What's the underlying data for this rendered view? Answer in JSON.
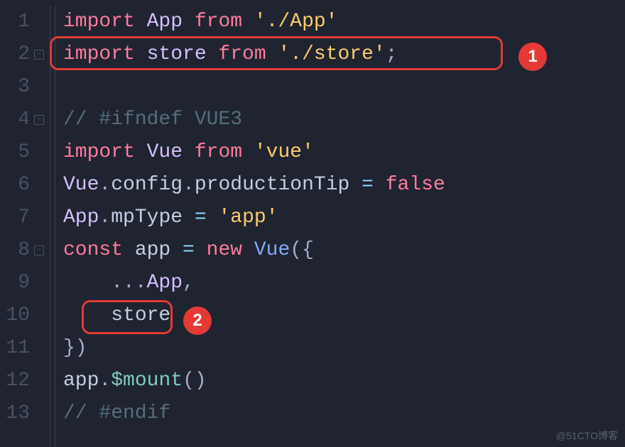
{
  "gutter": {
    "lines": [
      {
        "num": "1",
        "fold": false
      },
      {
        "num": "2",
        "fold": true
      },
      {
        "num": "3",
        "fold": false
      },
      {
        "num": "4",
        "fold": true
      },
      {
        "num": "5",
        "fold": false
      },
      {
        "num": "6",
        "fold": false
      },
      {
        "num": "7",
        "fold": false
      },
      {
        "num": "8",
        "fold": true
      },
      {
        "num": "9",
        "fold": false
      },
      {
        "num": "10",
        "fold": false
      },
      {
        "num": "11",
        "fold": false
      },
      {
        "num": "12",
        "fold": false
      },
      {
        "num": "13",
        "fold": false
      }
    ]
  },
  "code": {
    "l1": {
      "a": "import",
      "b": " App ",
      "c": "from",
      "d": " './App'"
    },
    "l2": {
      "a": "import",
      "b": " store ",
      "c": "from",
      "d": " './store'",
      "e": ";"
    },
    "l3": {
      "a": ""
    },
    "l4": {
      "a": "// #ifndef VUE3"
    },
    "l5": {
      "a": "import",
      "b": " Vue ",
      "c": "from",
      "d": " 'vue'"
    },
    "l6": {
      "a": "Vue",
      "b": ".",
      "c": "config",
      "d": ".",
      "e": "productionTip",
      "f": " = ",
      "g": "false"
    },
    "l7": {
      "a": "App",
      "b": ".",
      "c": "mpType",
      "d": " = ",
      "e": "'app'"
    },
    "l8": {
      "a": "const",
      "b": " app ",
      "c": "= ",
      "d": "new",
      "e": " Vue",
      "f": "({"
    },
    "l9": {
      "a": "    ...",
      "b": "App",
      "c": ","
    },
    "l10": {
      "a": "    ",
      "b": "store"
    },
    "l11": {
      "a": "})"
    },
    "l12": {
      "a": "app",
      "b": ".",
      "c": "$mount",
      "d": "()"
    },
    "l13": {
      "a": "// #endif"
    }
  },
  "annotations": {
    "badge1": "1",
    "badge2": "2"
  },
  "watermark": "@51CTO博客",
  "foldGlyph": "−"
}
